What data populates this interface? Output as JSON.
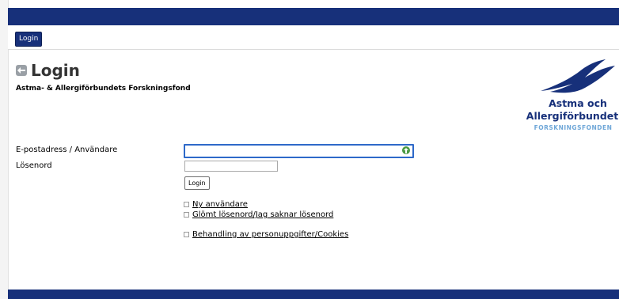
{
  "nav": {
    "login_button": "Login"
  },
  "header": {
    "title": "Login",
    "subtitle": "Astma- & Allergiförbundets Forskningsfond"
  },
  "logo": {
    "line1": "Astma och",
    "line2": "Allergiförbundet",
    "line3": "FORSKNINGSFONDEN",
    "brand_color": "#17307a",
    "accent_color": "#6fa7d8"
  },
  "form": {
    "username_label": "E-postadress / Användare",
    "username_value": "",
    "password_label": "Lösenord",
    "password_value": "",
    "submit_label": "Login"
  },
  "links": [
    {
      "label": "Ny användare"
    },
    {
      "label": "Glömt lösenord/Jag saknar lösenord"
    },
    {
      "label": "Behandling av personuppgifter/Cookies"
    }
  ],
  "colors": {
    "top_bar": "#17307a",
    "input_focus": "#2e69c9"
  }
}
